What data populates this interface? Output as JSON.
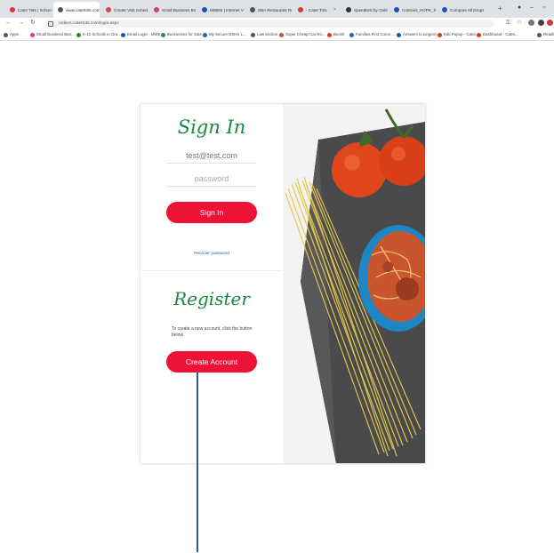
{
  "browser": {
    "tabs": [
      {
        "label": "Cater Tots | School",
        "color": "#d23b2d"
      },
      {
        "label": "www.catertots.com",
        "color": "#555555"
      },
      {
        "label": "Create Visit Sched",
        "color": "#d84a3b"
      },
      {
        "label": "Small Business Bo",
        "color": "#d13c8a"
      },
      {
        "label": "MWEB | Internet V",
        "color": "#1a56b0"
      },
      {
        "label": "SBA Restaurant Re",
        "color": "#555555"
      },
      {
        "label": "- Cater Tots",
        "color": "#d23b2d"
      },
      {
        "label": "Speedtest by Ookl",
        "color": "#333333"
      },
      {
        "label": "Contract_HOPE_Sc",
        "color": "#1a56b0"
      },
      {
        "label": "Compare All Drops",
        "color": "#1a56b0"
      }
    ],
    "new_tab": "+",
    "address": "ordiers.catertots.com/login.aspx",
    "bookmarks": [
      {
        "label": "Apps",
        "color": "#555555"
      },
      {
        "label": "Small Business Ban...",
        "color": "#d13c8a"
      },
      {
        "label": "K-12 Schools in Ora...",
        "color": "#3b7c2f"
      },
      {
        "label": "Email Login · MWE...",
        "color": "#1a56b0"
      },
      {
        "label": "Businesses for Sale...",
        "color": "#2f8a4a"
      },
      {
        "label": "My Secure DSHS L...",
        "color": "#2a5fa8"
      },
      {
        "label": "Law section",
        "color": "#555555"
      },
      {
        "label": "Super Cheap Car Ro...",
        "color": "#c94c4c"
      },
      {
        "label": "Boonli",
        "color": "#d23b2d"
      },
      {
        "label": "Families First Coron...",
        "color": "#2a5fa8"
      },
      {
        "label": "Answers to Lingerin...",
        "color": "#1a56b0"
      },
      {
        "label": "Edit Popup - Cater...",
        "color": "#d23b2d"
      },
      {
        "label": "Dashboard - Cater...",
        "color": "#d23b2d"
      },
      {
        "label": "Readin",
        "color": "#555555"
      }
    ]
  },
  "signin": {
    "title": "Sign In",
    "email_value": "test@test.com",
    "password_placeholder": "password",
    "button": "Sign In",
    "recover_link": "Recover password"
  },
  "register": {
    "title": "Register",
    "text": "To create a new account, click the button below.",
    "button": "Create Account"
  },
  "colors": {
    "accent": "#ee1236",
    "script": "#1b8a3f",
    "link": "#2a5fa8",
    "pointer": "#2d5aa0"
  }
}
